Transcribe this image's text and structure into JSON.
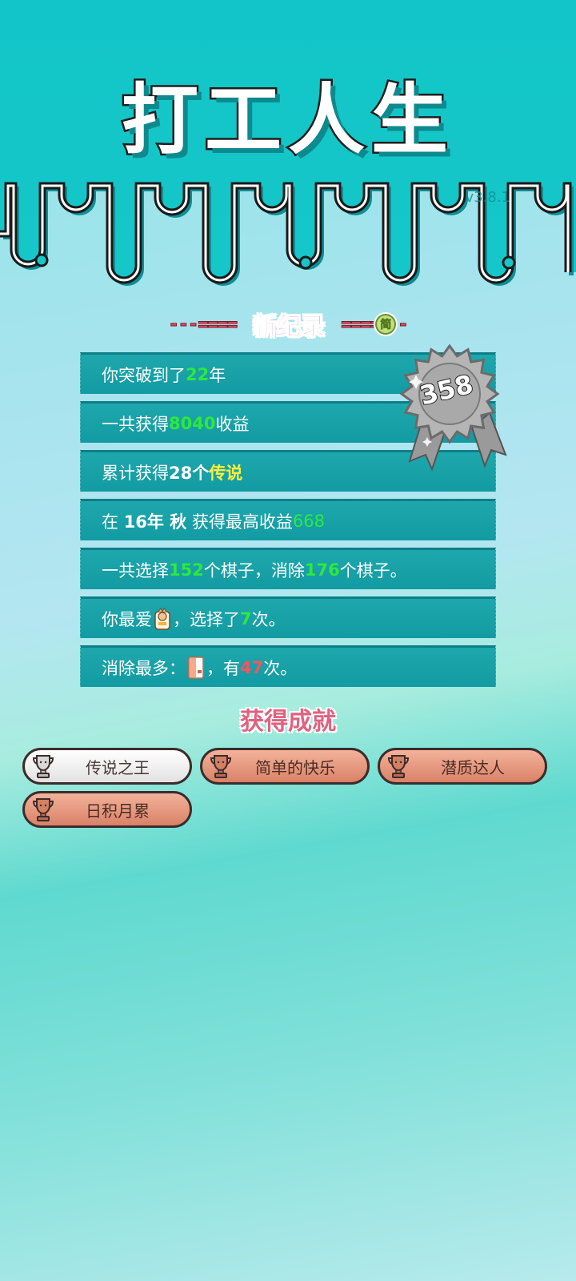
{
  "header": {
    "title": "打工人生",
    "version": "v3.8.1"
  },
  "record": {
    "title": "新纪录",
    "dash_left": "---====",
    "dash_right": "====",
    "mode_badge": "简",
    "score": "358"
  },
  "stats": [
    {
      "pre": "你突破到了",
      "val": "22",
      "post": "年"
    },
    {
      "pre": "一共获得",
      "val": "8040",
      "post": "收益"
    },
    {
      "pre": "累计获得",
      "val": "28个",
      "post": "",
      "val2": "传说"
    },
    {
      "a": "在 ",
      "b": "16年 秋",
      "c": " 获得最高收益",
      "val": "668"
    },
    {
      "a": "一共选择",
      "v1": "152",
      "b": "个棋子，消除",
      "v2": "176",
      "c": "个棋子。"
    },
    {
      "a": "你最爱",
      "b": "，选择了",
      "val": "7",
      "c": "次。"
    },
    {
      "a": "消除最多：",
      "b": "，有",
      "val": "47",
      "c": "次。"
    }
  ],
  "achievements": {
    "title": "获得成就",
    "items": [
      {
        "label": "传说之王",
        "tier": "silver"
      },
      {
        "label": "简单的快乐",
        "tier": "bronze"
      },
      {
        "label": "潜质达人",
        "tier": "bronze"
      },
      {
        "label": "日积月累",
        "tier": "bronze"
      }
    ]
  },
  "colors": {
    "teal": "#14c4c7",
    "row": "#129ba2",
    "green": "#2ee83f",
    "yellow": "#ffef3a",
    "red": "#f25560",
    "pink": "#e8455b"
  }
}
